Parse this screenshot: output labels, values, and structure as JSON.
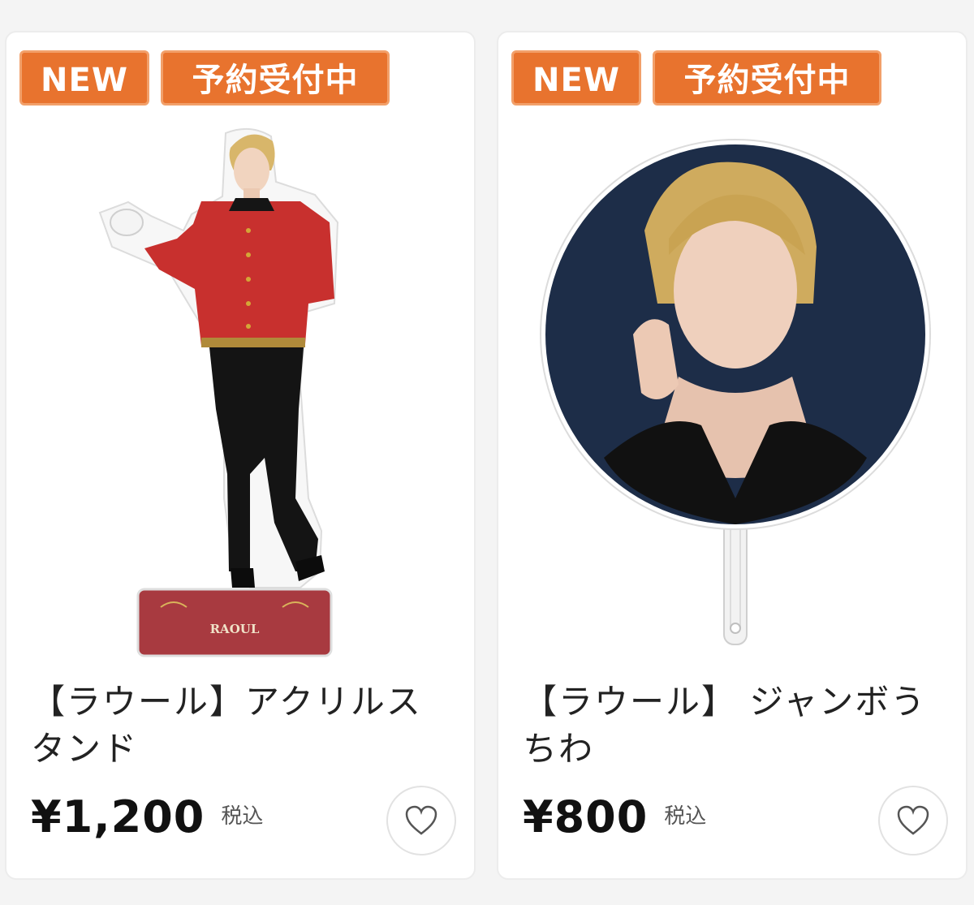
{
  "colors": {
    "badge": "#e8732e",
    "badge_border": "#f2a06a"
  },
  "products": [
    {
      "badge_new": "NEW",
      "badge_status": "予約受付中",
      "title": "【ラウール】アクリルスタンド",
      "price": "¥1,200",
      "tax_label": "税込",
      "image_icon": "acrylic-stand-figure",
      "base_text": "RAOUL"
    },
    {
      "badge_new": "NEW",
      "badge_status": "予約受付中",
      "title": "【ラウール】 ジャンボうちわ",
      "price": "¥800",
      "tax_label": "税込",
      "image_icon": "jumbo-uchiwa-fan"
    }
  ],
  "favorite_icon": "heart-outline-icon"
}
